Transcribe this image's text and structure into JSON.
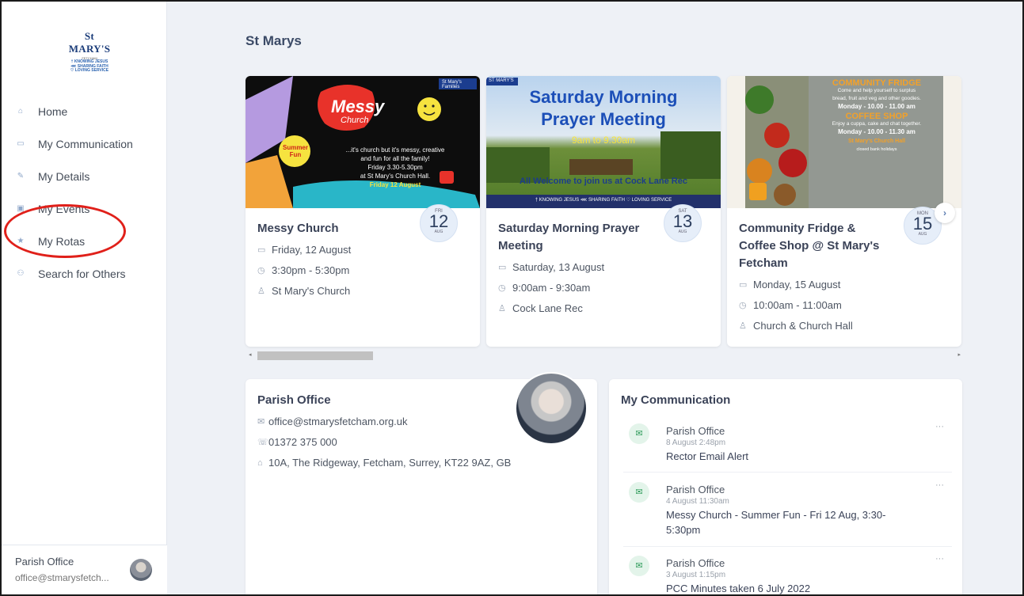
{
  "sidebar": {
    "logo": {
      "name": "St MARY'S",
      "place": "FETCHAM",
      "tag1": "† KNOWING JESUS",
      "tag2": "⋘ SHARING FAITH",
      "tag3": "♡ LOVING SERVICE"
    },
    "items": [
      {
        "label": "Home",
        "icon": "home-icon"
      },
      {
        "label": "My Communication",
        "icon": "chat-icon"
      },
      {
        "label": "My Details",
        "icon": "pencil-icon"
      },
      {
        "label": "My Events",
        "icon": "calendar-icon"
      },
      {
        "label": "My Rotas",
        "icon": "star-icon"
      },
      {
        "label": "Search for Others",
        "icon": "people-icon"
      }
    ],
    "user": {
      "name": "Parish Office",
      "email": "office@stmarysfetch..."
    }
  },
  "page": {
    "title": "St Marys"
  },
  "events": [
    {
      "title": "Messy Church",
      "weekday": "FRI",
      "day": "12",
      "month": "AUG",
      "date": "Friday, 12 August",
      "time": "3:30pm - 5:30pm",
      "location": "St Mary's Church",
      "image": {
        "title": "Messy",
        "sub": "Church",
        "badge": "Summer Fun",
        "brand": "St Mary's Families",
        "text1": "...it's church but it's messy, creative",
        "text2": "and fun for all the family!",
        "text3": "Friday 3.30-5.30pm",
        "text4": "at St Mary's Church Hall.",
        "text5": "Friday 12 August"
      }
    },
    {
      "title": "Saturday Morning Prayer Meeting",
      "weekday": "SAT",
      "day": "13",
      "month": "AUG",
      "date": "Saturday, 13 August",
      "time": "9:00am - 9:30am",
      "location": "Cock Lane Rec",
      "image": {
        "brand": "ST MARY'S",
        "line1": "Saturday Morning",
        "line2": "Prayer Meeting",
        "line3": "9am to 9.30am",
        "line4": "All Welcome to join us at Cock Lane Rec",
        "line5": "† KNOWING JESUS ⋘ SHARING FAITH ♡ LOVING SERVICE"
      }
    },
    {
      "title": "Community Fridge & Coffee Shop @ St Mary's Fetcham",
      "weekday": "MON",
      "day": "15",
      "month": "AUG",
      "date": "Monday, 15 August",
      "time": "10:00am - 11:00am",
      "location": "Church & Church Hall",
      "image": {
        "line1": "COMMUNITY FRIDGE",
        "line2": "Come and help yourself to surplus",
        "line3": "bread, fruit and veg and other goodies.",
        "line4": "Monday - 10.00 - 11.00 am",
        "line5": "COFFEE SHOP",
        "line6": "Enjoy a cuppa, cake and chat together.",
        "line7": "Monday - 10.00 - 11.30 am",
        "line8": "St Mary's Church Hall",
        "line9": "closed bank holidays"
      }
    }
  ],
  "parish": {
    "title": "Parish Office",
    "email": "office@stmarysfetcham.org.uk",
    "phone": "01372 375 000",
    "address": "10A, The Ridgeway, Fetcham, Surrey, KT22 9AZ, GB"
  },
  "communication": {
    "title": "My Communication",
    "messages": [
      {
        "from": "Parish Office",
        "time": "8 August 2:48pm",
        "subject": "Rector Email Alert"
      },
      {
        "from": "Parish Office",
        "time": "4 August 11:30am",
        "subject": "Messy Church - Summer Fun - Fri 12 Aug, 3:30-5:30pm"
      },
      {
        "from": "Parish Office",
        "time": "3 August 1:15pm",
        "subject": "PCC Minutes taken 6 July 2022"
      }
    ]
  },
  "colors": {
    "accent": "#3b4a66",
    "annotation": "#e0201a",
    "mail": "#2e9b5a"
  }
}
